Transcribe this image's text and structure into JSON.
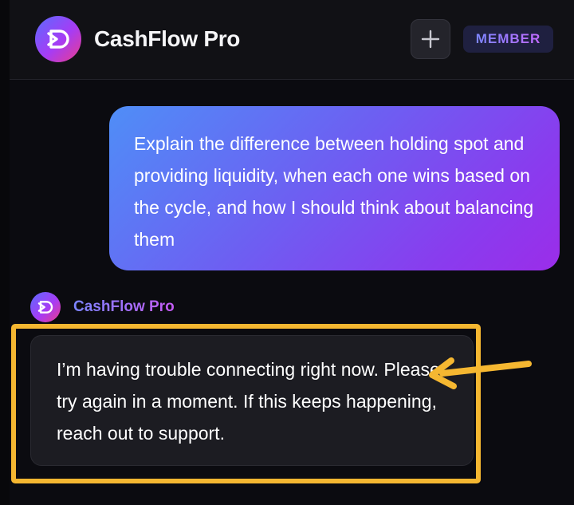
{
  "header": {
    "app_title": "CashFlow Pro",
    "logo_icon": "cashflow-logo-icon",
    "new_chat_icon": "plus-icon",
    "badge": "MEMBER"
  },
  "conversation": {
    "user_message": "Explain the difference between holding spot and providing liquidity, when each one wins based on the cycle, and how I should think about balancing them",
    "assistant_name": "CashFlow Pro",
    "assistant_message": "I’m having trouble connecting right now. Please try again in a moment. If this keeps happening, reach out to support."
  },
  "annotation": {
    "highlight_color": "#f5b731",
    "arrow_icon": "arrow-left-icon"
  },
  "colors": {
    "background": "#0b0b10",
    "header": "#111115",
    "user_bubble_start": "#4f8ef7",
    "user_bubble_end": "#9b2de9",
    "assistant_bubble": "#1c1c22",
    "badge_bg": "#1f2040"
  }
}
